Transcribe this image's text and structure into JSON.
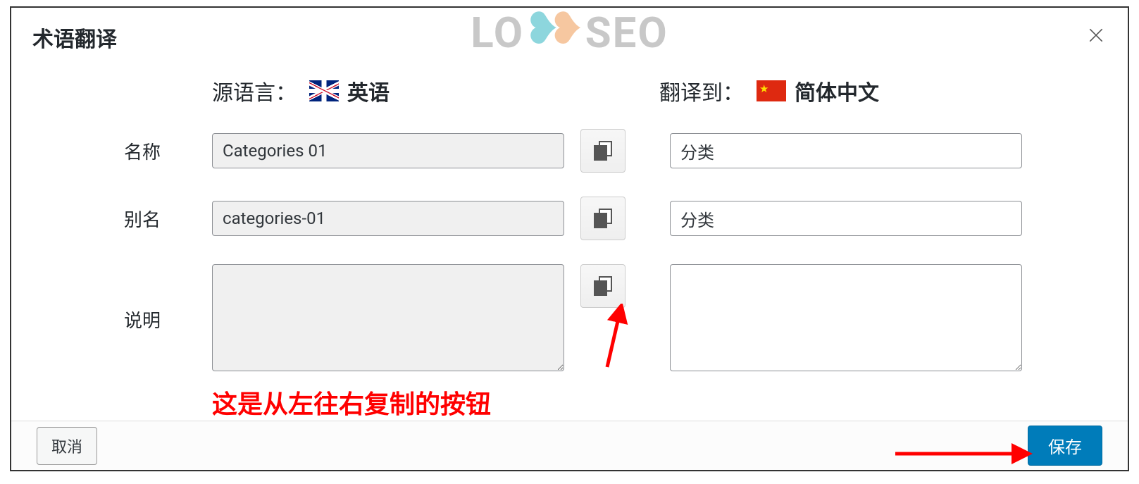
{
  "dialog": {
    "title": "术语翻译",
    "watermark": {
      "part1": "LO",
      "part2": "SEO"
    }
  },
  "languages": {
    "source_label": "源语言：",
    "source_name": "英语",
    "target_label": "翻译到：",
    "target_name": "简体中文"
  },
  "rows": {
    "name": {
      "label": "名称",
      "source_value": "Categories 01",
      "target_value": "分类"
    },
    "slug": {
      "label": "别名",
      "source_value": "categories-01",
      "target_value": "分类"
    },
    "description": {
      "label": "说明",
      "source_value": "",
      "target_value": ""
    }
  },
  "annotations": {
    "copy_button_note": "这是从左往右复制的按钮"
  },
  "footer": {
    "cancel": "取消",
    "save": "保存"
  }
}
